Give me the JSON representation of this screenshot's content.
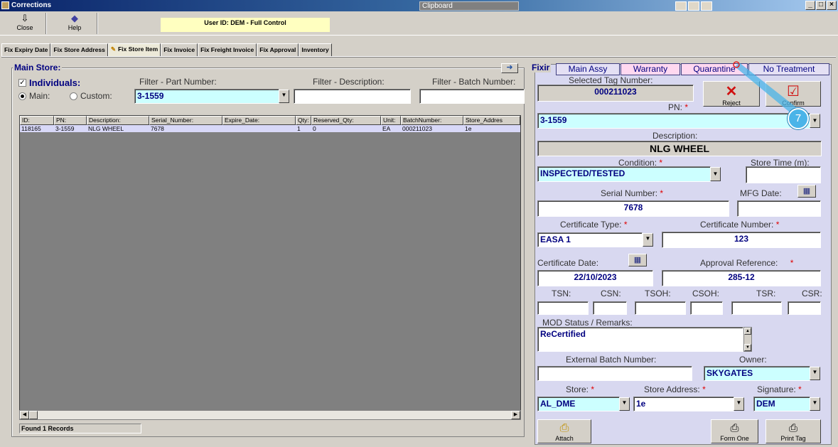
{
  "window": {
    "title": "Corrections",
    "clipboard_label": "Clipboard"
  },
  "toolbar": {
    "close_label": "Close",
    "help_label": "Help",
    "user_id": "User ID: DEM - Full Control"
  },
  "tabs": [
    {
      "label": "Fix Expiry Date",
      "active": false
    },
    {
      "label": "Fix Store Address",
      "active": false
    },
    {
      "label": "Fix Store Item",
      "active": true
    },
    {
      "label": "Fix Invoice",
      "active": false
    },
    {
      "label": "Fix Freight Invoice",
      "active": false
    },
    {
      "label": "Fix Approval",
      "active": false
    },
    {
      "label": "Inventory",
      "active": false
    }
  ],
  "main_store": {
    "title": "Main Store:",
    "individuals_label": "Individuals:",
    "individuals_checked": true,
    "main_label": "Main:",
    "custom_label": "Custom:",
    "main_selected": true,
    "filter_part_label": "Filter - Part Number:",
    "filter_part_value": "3-1559",
    "filter_desc_label": "Filter - Description:",
    "filter_desc_value": "",
    "filter_batch_label": "Filter - Batch Number:",
    "filter_batch_value": ""
  },
  "grid": {
    "columns": [
      "ID:",
      "PN:",
      "Description:",
      "Serial_Number:",
      "Expire_Date:",
      "Qty:",
      "Reserved_Qty:",
      "Unit:",
      "BatchNumber:",
      "Store_Addres"
    ],
    "rows": [
      [
        "118165",
        "3-1559",
        "NLG WHEEL",
        "7678",
        "",
        "1",
        "0",
        "EA",
        "000211023",
        "1e"
      ]
    ],
    "status": "Found 1 Records"
  },
  "fix_panel": {
    "title": "Fixir",
    "tabs": [
      {
        "label": "Main Assy"
      },
      {
        "label": "Warranty"
      },
      {
        "label": "Quarantine"
      },
      {
        "label": "No Treatment"
      }
    ],
    "selected_tag_label": "Selected Tag Number:",
    "selected_tag_value": "000211023",
    "reject_label": "Reject",
    "confirm_label": "Confirm",
    "pn_label": "PN:",
    "pn_value": "3-1559",
    "description_label": "Description:",
    "description_value": "NLG WHEEL",
    "condition_label": "Condition:",
    "condition_value": "INSPECTED/TESTED",
    "store_time_label": "Store Time (m):",
    "store_time_value": "",
    "serial_label": "Serial Number:",
    "serial_value": "7678",
    "mfg_label": "MFG Date:",
    "mfg_value": "",
    "cert_type_label": "Certificate Type:",
    "cert_type_value": "EASA 1",
    "cert_number_label": "Certificate Number:",
    "cert_number_value": "123",
    "cert_date_label": "Certificate Date:",
    "cert_date_value": "22/10/2023",
    "approval_label": "Approval Reference:",
    "approval_value": "285-12",
    "tsn_label": "TSN:",
    "csn_label": "CSN:",
    "tsoh_label": "TSOH:",
    "csoh_label": "CSOH:",
    "tsr_label": "TSR:",
    "csr_label": "CSR:",
    "mod_label": "MOD Status / Remarks:",
    "mod_value": "ReCertified",
    "ext_batch_label": "External Batch Number:",
    "ext_batch_value": "",
    "owner_label": "Owner:",
    "owner_value": "SKYGATES",
    "store_label": "Store:",
    "store_value": "AL_DME",
    "store_addr_label": "Store Address:",
    "store_addr_value": "1e",
    "signature_label": "Signature:",
    "signature_value": "DEM",
    "attach_label": "Attach",
    "form_one_label": "Form One",
    "print_tag_label": "Print Tag"
  },
  "annotation": {
    "number": "7",
    "color": "#4ab4e8"
  }
}
